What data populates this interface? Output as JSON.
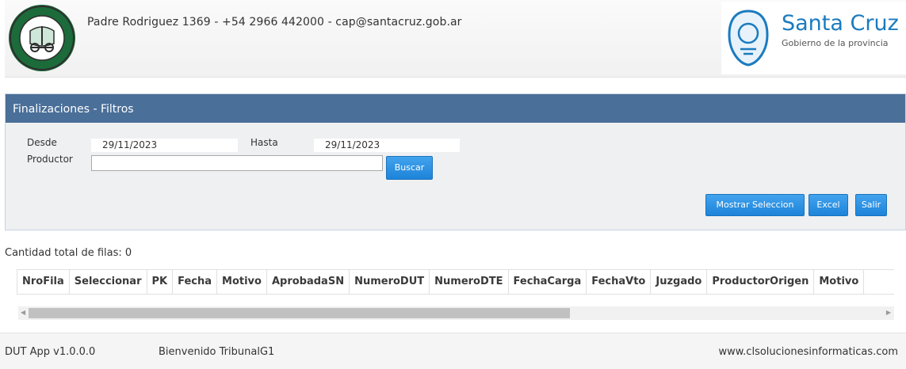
{
  "header": {
    "contact": "Padre Rodriguez 1369 - +54 2966 442000 - cap@santacruz.gob.ar",
    "brand_title": "Santa Cruz",
    "brand_subtitle": "Gobierno de la provincia",
    "logo_left_icon": "consejo-agrario-seal-icon",
    "logo_right_icon": "santa-cruz-shield-icon"
  },
  "panel": {
    "title": "Finalizaciones - Filtros",
    "desde_label": "Desde",
    "desde_value": "29/11/2023",
    "hasta_label": "Hasta",
    "hasta_value": "29/11/2023",
    "productor_label": "Productor",
    "productor_value": "",
    "buscar_label": "Buscar",
    "mostrar_label": "Mostrar Seleccion",
    "excel_label": "Excel",
    "salir_label": "Salir"
  },
  "results": {
    "row_count_text": "Cantidad total de filas: 0",
    "columns": [
      "NroFila",
      "Seleccionar",
      "PK",
      "Fecha",
      "Motivo",
      "AprobadaSN",
      "NumeroDUT",
      "NumeroDTE",
      "FechaCarga",
      "FechaVto",
      "Juzgado",
      "ProductorOrigen",
      "Motivo"
    ]
  },
  "footer": {
    "version": "DUT App v1.0.0.0",
    "welcome": "Bienvenido TribunalG1",
    "website": "www.clsolucionesinformaticas.com"
  },
  "colors": {
    "panel_header": "#4a6f99",
    "button": "#1d84d9",
    "brand": "#1a7bbf"
  }
}
